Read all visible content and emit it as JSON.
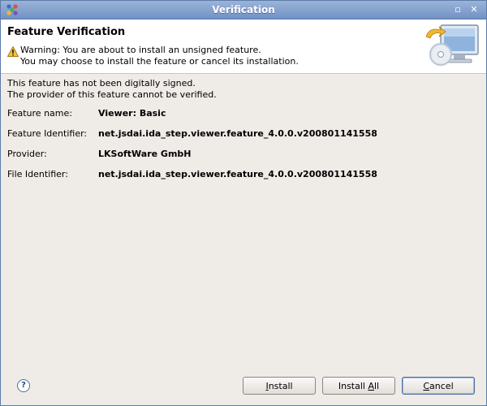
{
  "window": {
    "title": "Verification",
    "minimize_glyph": "▫",
    "close_glyph": "✕"
  },
  "header": {
    "title": "Feature Verification",
    "warning_line1": "Warning: You are about to install an unsigned feature.",
    "warning_line2": "You may choose to install the feature or cancel its installation.",
    "icons": [
      "app-logo-icon",
      "warning-icon",
      "install-computer-icon"
    ]
  },
  "notice": {
    "line1": "This feature has not been digitally signed.",
    "line2": "The provider of this feature cannot be verified."
  },
  "details": [
    {
      "label": "Feature name:",
      "value": "Viewer: Basic"
    },
    {
      "label": "Feature Identifier:",
      "value": "net.jsdai.ida_step.viewer.feature_4.0.0.v200801141558"
    },
    {
      "label": "Provider:",
      "value": "LKSoftWare GmbH"
    },
    {
      "label": "File Identifier:",
      "value": "net.jsdai.ida_step.viewer.feature_4.0.0.v200801141558"
    }
  ],
  "buttons": {
    "help_glyph": "?",
    "install_prefix": "",
    "install_mnemonic": "I",
    "install_suffix": "nstall",
    "install_all_prefix": "Install ",
    "install_all_mnemonic": "A",
    "install_all_suffix": "ll",
    "cancel_prefix": "",
    "cancel_mnemonic": "C",
    "cancel_suffix": "ancel"
  },
  "colors": {
    "titlebar": "#7f9cc9",
    "dialog_bg": "#efebe7",
    "header_bg": "#ffffff"
  }
}
